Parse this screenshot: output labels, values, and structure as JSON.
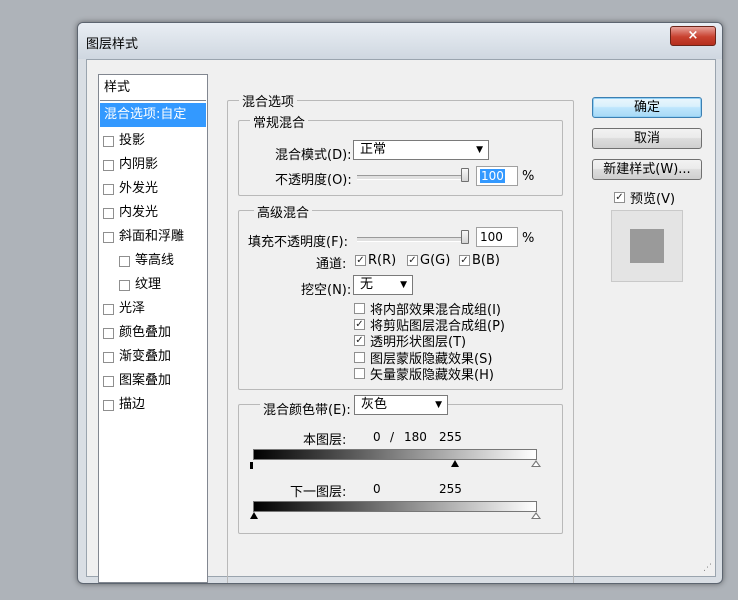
{
  "window": {
    "title": "图层样式",
    "close_glyph": "×"
  },
  "styles_panel": {
    "header": "样式",
    "items": [
      {
        "label": "混合选项:自定",
        "selected": true
      },
      {
        "label": "投影",
        "checked": false
      },
      {
        "label": "内阴影",
        "checked": false
      },
      {
        "label": "外发光",
        "checked": false
      },
      {
        "label": "内发光",
        "checked": false
      },
      {
        "label": "斜面和浮雕",
        "checked": false
      },
      {
        "label": "等高线",
        "checked": false
      },
      {
        "label": "纹理",
        "checked": false
      },
      {
        "label": "光泽",
        "checked": false
      },
      {
        "label": "颜色叠加",
        "checked": false
      },
      {
        "label": "渐变叠加",
        "checked": false
      },
      {
        "label": "图案叠加",
        "checked": false
      },
      {
        "label": "描边",
        "checked": false
      }
    ]
  },
  "blending_options": {
    "title": "混合选项",
    "general": {
      "title": "常规混合",
      "mode_label": "混合模式(D):",
      "mode_value": "正常",
      "opacity_label": "不透明度(O):",
      "opacity_value": "100",
      "opacity_unit": "%"
    },
    "advanced": {
      "title": "高级混合",
      "fill_label": "填充不透明度(F):",
      "fill_value": "100",
      "fill_unit": "%",
      "channels_label": "通道:",
      "channel_r": "R(R)",
      "channel_g": "G(G)",
      "channel_b": "B(B)",
      "knockout_label": "挖空(N):",
      "knockout_value": "无",
      "options": [
        {
          "label": "将内部效果混合成组(I)",
          "checked": false
        },
        {
          "label": "将剪贴图层混合成组(P)",
          "checked": true
        },
        {
          "label": "透明形状图层(T)",
          "checked": true
        },
        {
          "label": "图层蒙版隐藏效果(S)",
          "checked": false
        },
        {
          "label": "矢量蒙版隐藏效果(H)",
          "checked": false
        }
      ]
    },
    "blend_if": {
      "label": "混合颜色带(E):",
      "value": "灰色",
      "this_layer_label": "本图层:",
      "this_layer_low": "0",
      "this_layer_sep": "/",
      "this_layer_split": "180",
      "this_layer_high": "255",
      "underlying_label": "下一图层:",
      "underlying_low": "0",
      "underlying_high": "255"
    }
  },
  "buttons": {
    "ok": "确定",
    "cancel": "取消",
    "new_style": "新建样式(W)...",
    "preview_label": "预览(V)"
  }
}
